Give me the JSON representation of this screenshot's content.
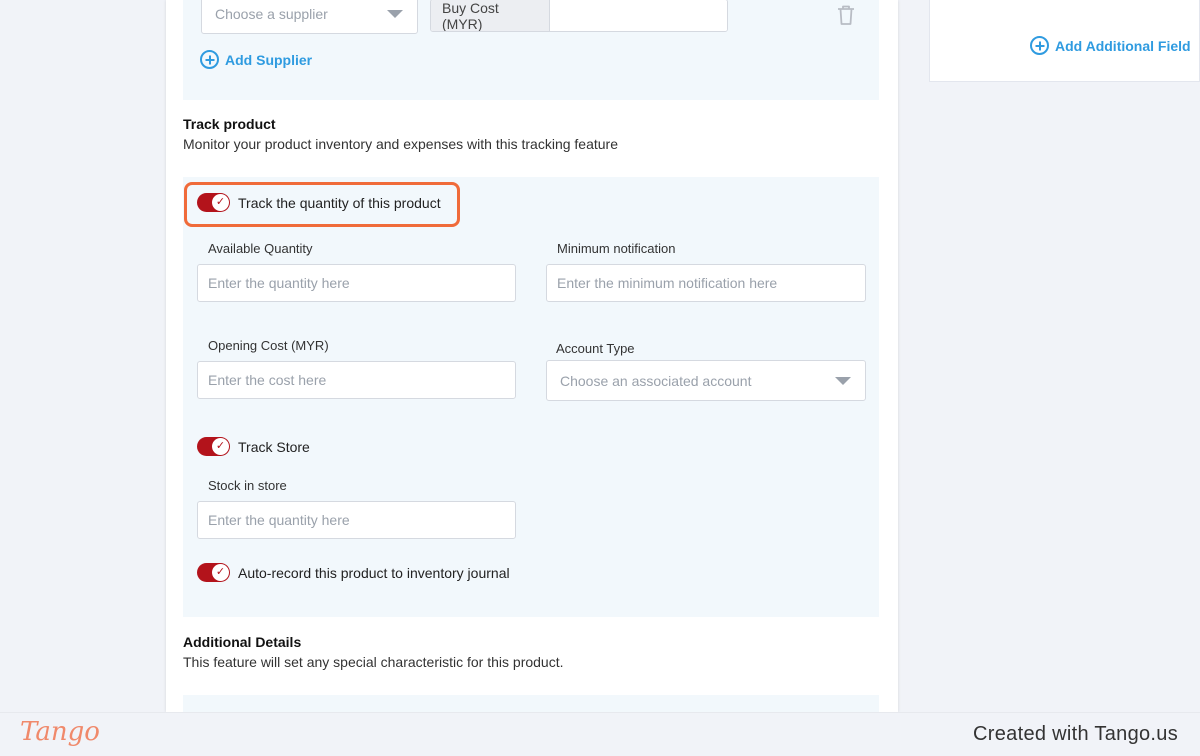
{
  "supplier": {
    "placeholder": "Choose a supplier",
    "buy_cost_label": "Buy Cost (MYR)",
    "buy_cost_value": "",
    "add_supplier": "Add Supplier"
  },
  "sidebar": {
    "add_field": "Add Additional Field"
  },
  "track": {
    "title": "Track product",
    "description": "Monitor your product inventory and expenses with this tracking feature",
    "toggle_quantity": "Track the quantity of this product",
    "available_qty_label": "Available Quantity",
    "available_qty_placeholder": "Enter the quantity here",
    "min_notif_label": "Minimum notification",
    "min_notif_placeholder": "Enter the minimum notification here",
    "opening_cost_label": "Opening Cost (MYR)",
    "opening_cost_placeholder": "Enter the cost here",
    "account_type_label": "Account Type",
    "account_type_placeholder": "Choose an associated account",
    "toggle_store": "Track Store",
    "stock_label": "Stock in store",
    "stock_placeholder": "Enter the quantity here",
    "toggle_auto": "Auto-record this product to inventory journal"
  },
  "additional": {
    "title": "Additional Details",
    "description": "This feature will set any special characteristic for this product."
  },
  "footer": {
    "logo": "Tango",
    "credit": "Created with Tango.us"
  },
  "colors": {
    "accent": "#2f9be0",
    "toggle": "#b3131b",
    "highlight": "#f06b3a"
  }
}
